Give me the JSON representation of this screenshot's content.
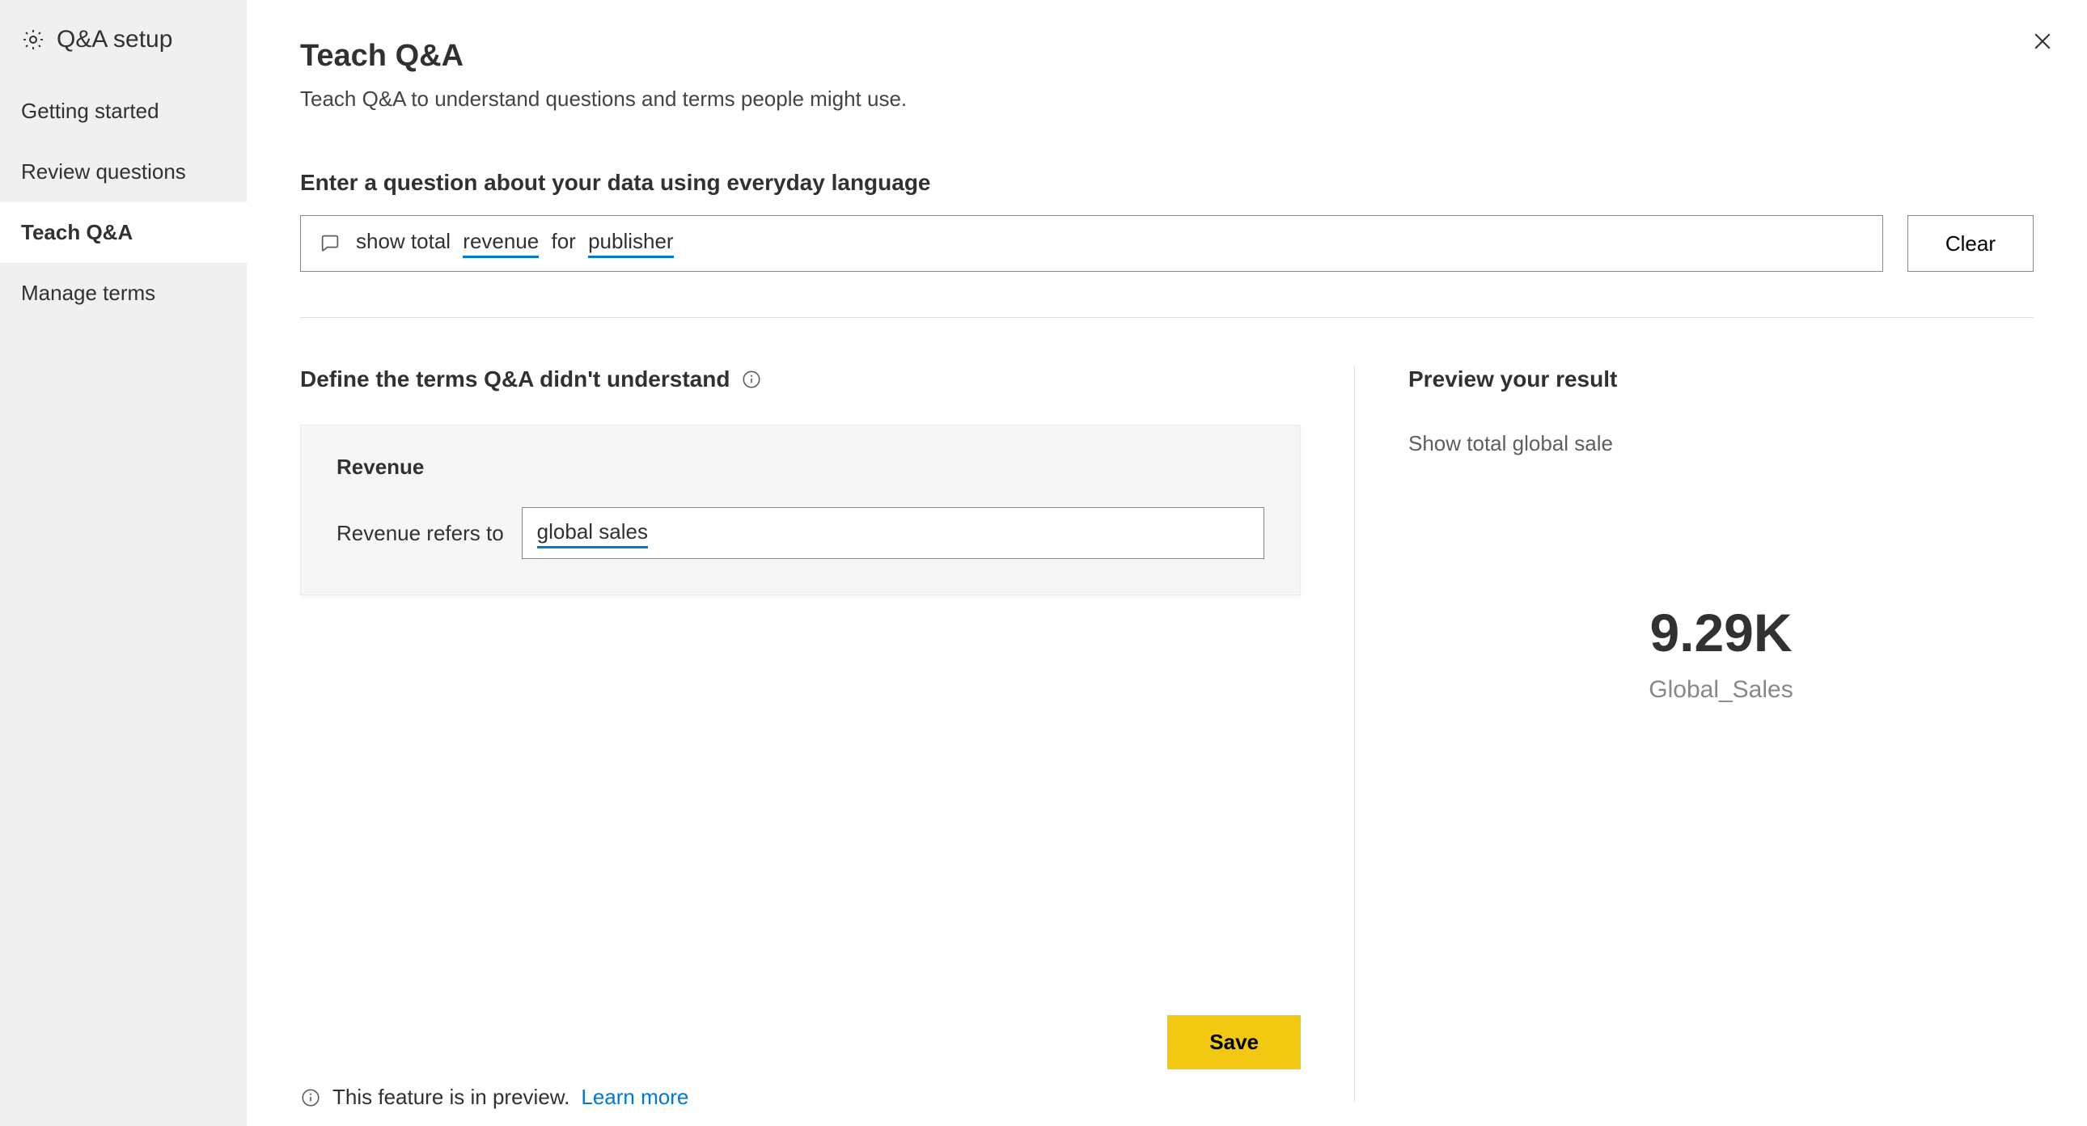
{
  "sidebar": {
    "title": "Q&A setup",
    "items": [
      {
        "label": "Getting started",
        "active": false
      },
      {
        "label": "Review questions",
        "active": false
      },
      {
        "label": "Teach Q&A",
        "active": true
      },
      {
        "label": "Manage terms",
        "active": false
      }
    ]
  },
  "header": {
    "title": "Teach Q&A",
    "subtitle": "Teach Q&A to understand questions and terms people might use."
  },
  "question_section": {
    "label": "Enter a question about your data using everyday language",
    "tokens": [
      {
        "text": "show total ",
        "underline": false
      },
      {
        "text": "revenue",
        "underline": true
      },
      {
        "text": " for ",
        "underline": false
      },
      {
        "text": "publisher",
        "underline": true
      }
    ],
    "clear_label": "Clear"
  },
  "define_section": {
    "title": "Define the terms Q&A didn't understand",
    "term": {
      "name": "Revenue",
      "refers_label": "Revenue refers to",
      "value": "global sales"
    }
  },
  "save_label": "Save",
  "preview": {
    "title": "Preview your result",
    "interpretation": "Show total global sale",
    "value": "9.29K",
    "value_label": "Global_Sales"
  },
  "footer": {
    "text": "This feature is in preview.",
    "link": "Learn more"
  }
}
